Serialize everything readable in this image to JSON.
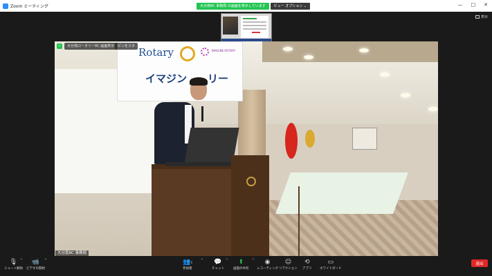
{
  "window": {
    "title": "Zoom ミーティング",
    "controls": [
      "—",
      "□",
      "✕"
    ]
  },
  "share_banner": {
    "status": "大分南RC 事務局 の画面を表示しています",
    "view_options": "ビュー オプション ⌄"
  },
  "display_button": {
    "label": "表示"
  },
  "video": {
    "viewing_label": "大分南ロータリーRC 画面表示",
    "annotate_label": "ピンをスタ",
    "participant_name": "大分南RC 事務局",
    "banner_rotary": "Rotary",
    "banner_imagine": "IMAGINE ROTARY",
    "banner_jp": "イマジン　　リー"
  },
  "toolbar": {
    "unmute": "ミュート解除",
    "start_video": "ビデオの開始",
    "participants": "参加者",
    "participants_count": "3",
    "chat": "チャット",
    "share_screen": "画面の共有",
    "record": "レコーディング",
    "reactions": "リアクション",
    "apps": "アプリ",
    "whiteboard": "ホワイトボード",
    "end": "退出"
  },
  "colors": {
    "share_green": "#23c552",
    "end_red": "#e02828",
    "background": "#1a1a1a"
  }
}
